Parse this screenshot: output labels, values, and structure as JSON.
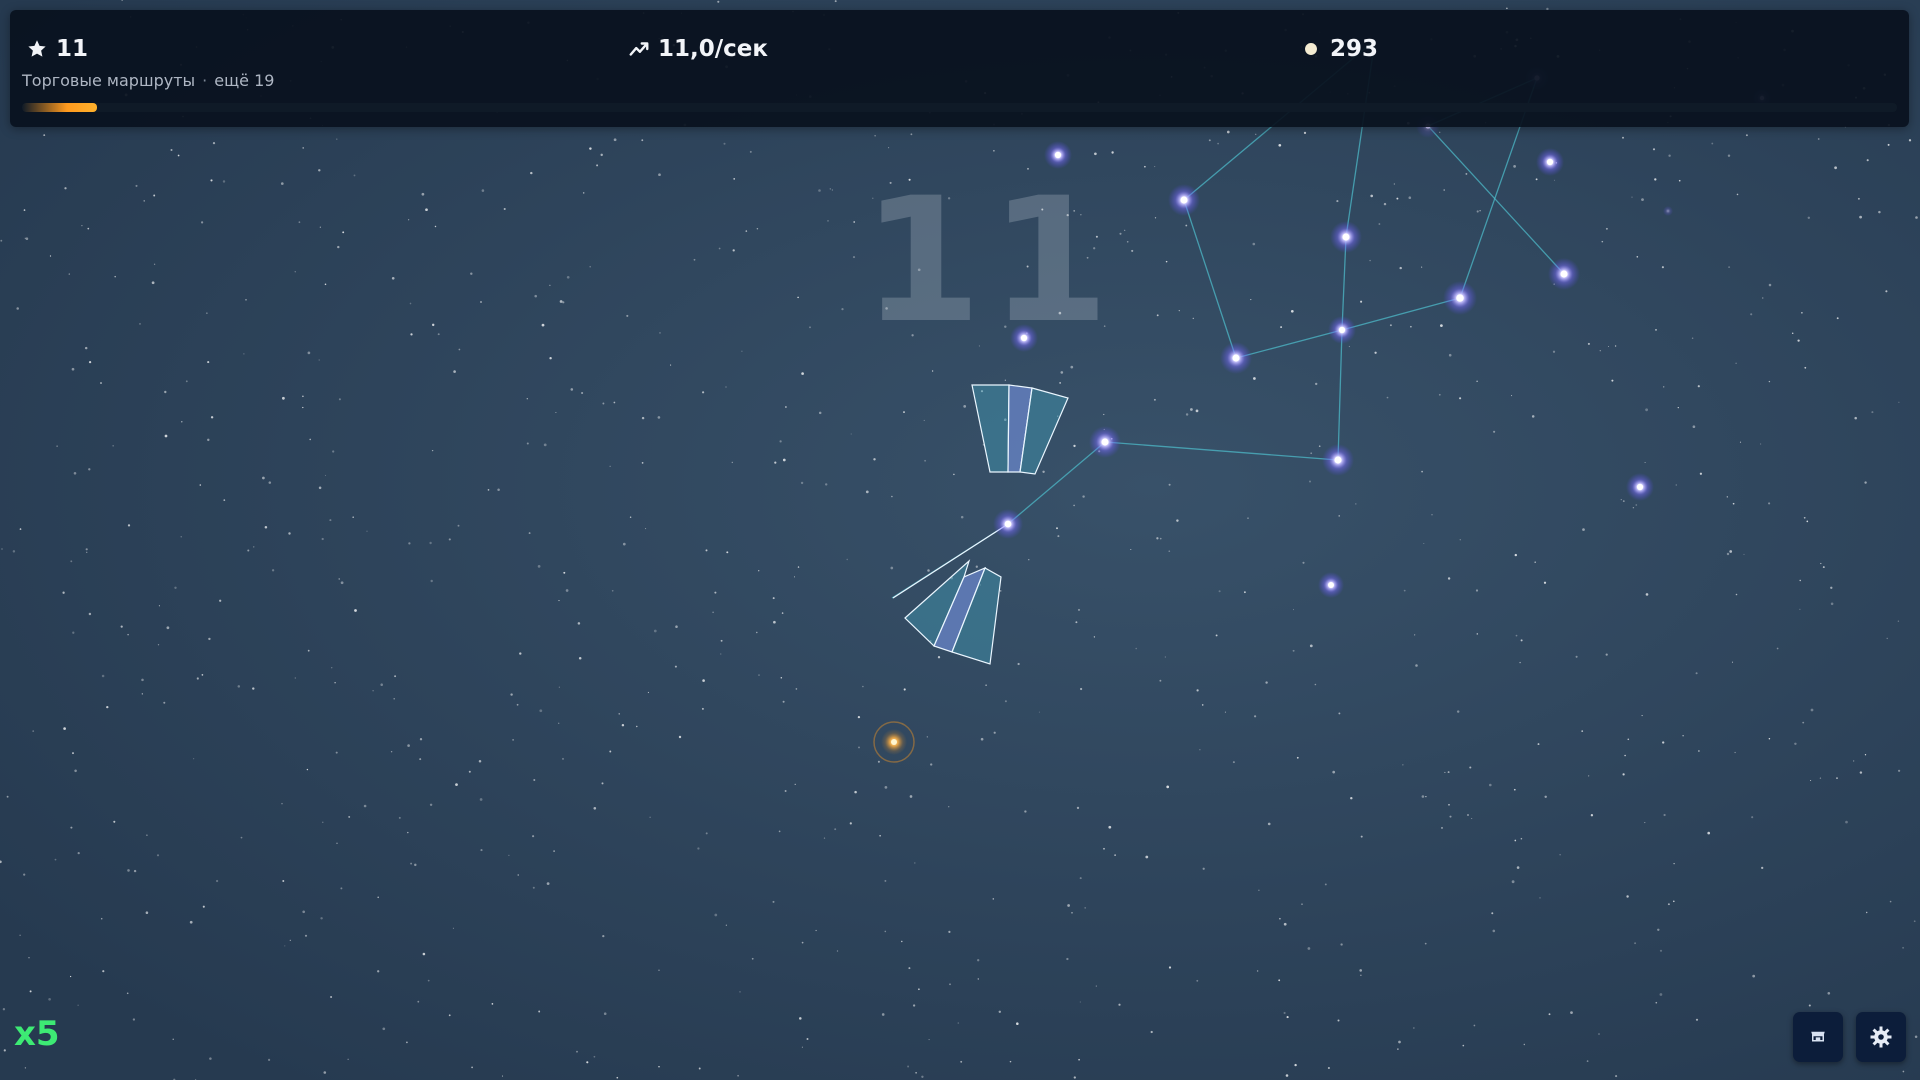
{
  "hud": {
    "stars": {
      "icon": "star-icon",
      "value": "11"
    },
    "rate": {
      "icon": "trend-up-icon",
      "value": "11,0/сек"
    },
    "coins": {
      "icon": "coin-icon",
      "value": "293"
    },
    "quest": {
      "title": "Торговые маршруты",
      "separator": "·",
      "remaining": "ещё 19",
      "progress": 0.04
    }
  },
  "main": {
    "big_score": "11",
    "multiplier": "x5"
  },
  "buttons": {
    "shop": {
      "icon": "shop-icon"
    },
    "settings": {
      "icon": "gear-icon"
    }
  },
  "colors": {
    "background": "#2e445b",
    "hud_panel": "#09111e",
    "star_glow": "#8f86ff",
    "link_line": "#4fc0cf",
    "progress": "#ff9a1e",
    "multiplier": "#3dea74",
    "sun": "#ffb347"
  }
}
